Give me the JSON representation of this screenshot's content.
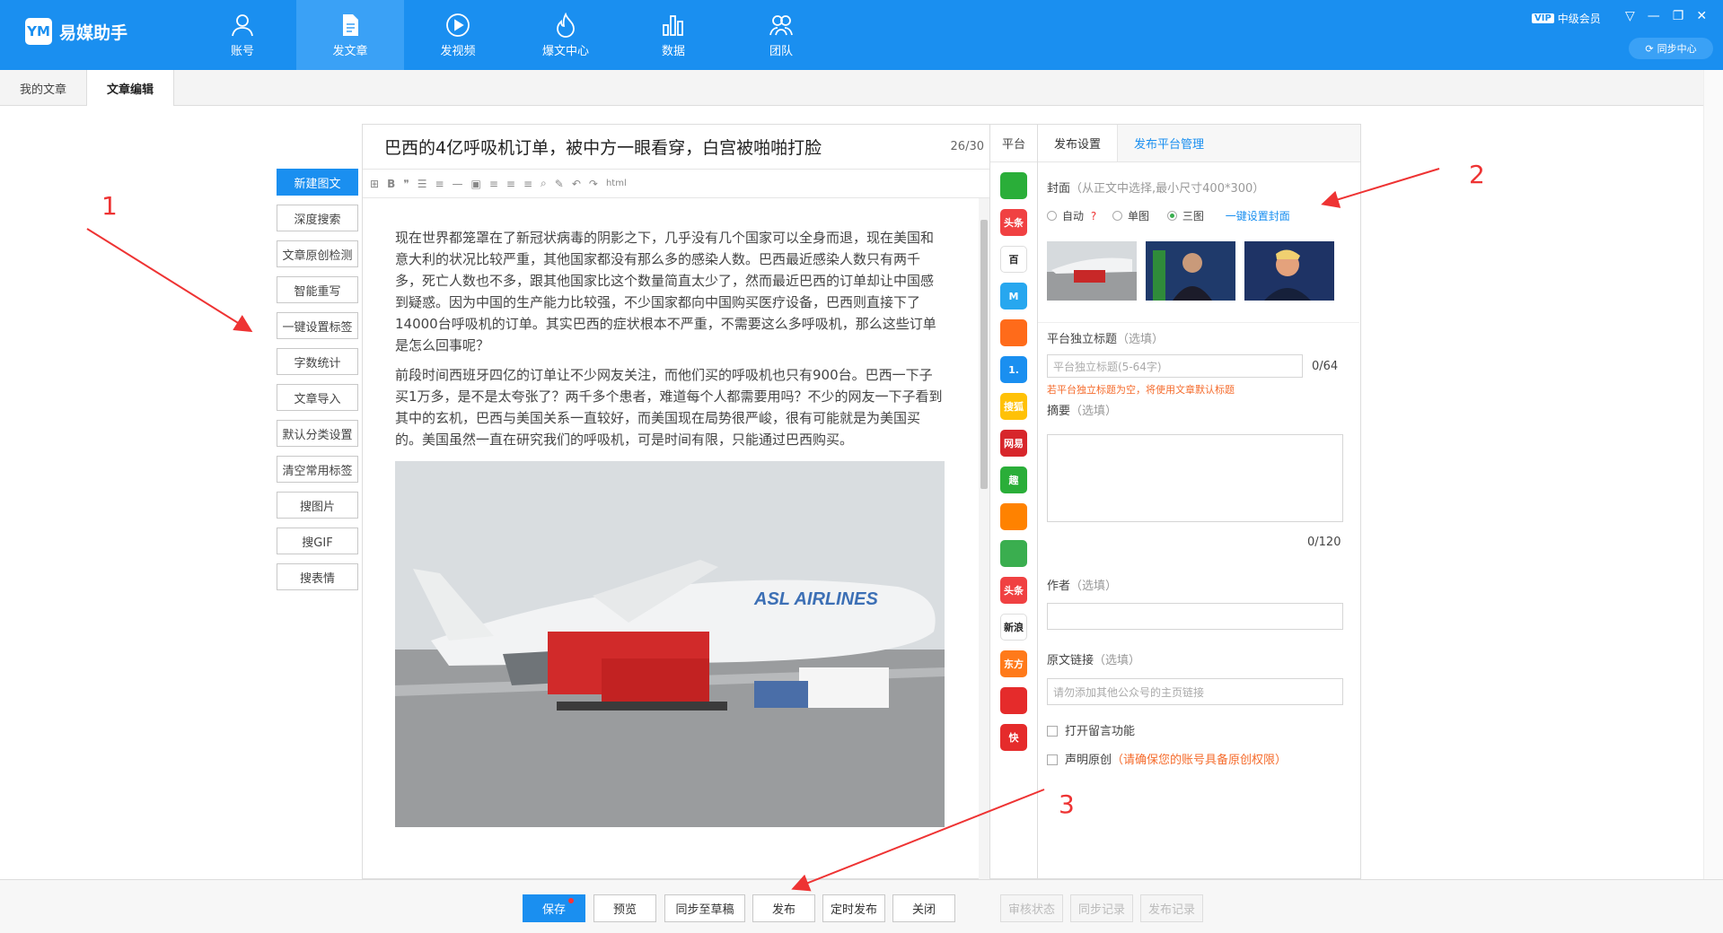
{
  "app": {
    "name": "易媒助手",
    "logo_text": "YM"
  },
  "nav": [
    {
      "label": "账号",
      "icon": "user-icon",
      "active": false
    },
    {
      "label": "发文章",
      "icon": "document-icon",
      "active": true
    },
    {
      "label": "发视频",
      "icon": "play-icon",
      "active": false
    },
    {
      "label": "爆文中心",
      "icon": "fire-icon",
      "active": false
    },
    {
      "label": "数据",
      "icon": "bar-chart-icon",
      "active": false
    },
    {
      "label": "团队",
      "icon": "team-icon",
      "active": false
    }
  ],
  "account": {
    "vip_badge": "VIP",
    "level": "中级会员",
    "sync_center": "同步中心"
  },
  "tabs": [
    {
      "label": "我的文章",
      "active": false
    },
    {
      "label": "文章编辑",
      "active": true
    }
  ],
  "tools": [
    "新建图文",
    "深度搜索",
    "文章原创检测",
    "智能重写",
    "一键设置标签",
    "字数统计",
    "文章导入",
    "默认分类设置",
    "清空常用标签",
    "搜图片",
    "搜GIF",
    "搜表情"
  ],
  "editor": {
    "title": "巴西的4亿呼吸机订单，被中方一眼看穿，白宫被啪啪打脸",
    "title_count": "26/30",
    "toolbar_html": "html",
    "paragraphs": [
      "现在世界都笼罩在了新冠状病毒的阴影之下，几乎没有几个国家可以全身而退，现在美国和意大利的状况比较严重，其他国家都没有那么多的感染人数。巴西最近感染人数只有两千多，死亡人数也不多，跟其他国家比这个数量简直太少了，然而最近巴西的订单却让中国感到疑惑。因为中国的生产能力比较强，不少国家都向中国购买医疗设备，巴西则直接下了14000台呼吸机的订单。其实巴西的症状根本不严重，不需要这么多呼吸机，那么这些订单是怎么回事呢？",
      "前段时间西班牙四亿的订单让不少网友关注，而他们买的呼吸机也只有900台。巴西一下子买1万多，是不是太夸张了？两千多个患者，难道每个人都需要用吗？不少的网友一下子看到其中的玄机，巴西与美国关系一直较好，而美国现在局势很严峻，很有可能就是为美国买的。美国虽然一直在研究我们的呼吸机，可是时间有限，只能通过巴西购买。"
    ],
    "image_caption": "ASL AIRLINES"
  },
  "platforms": {
    "header": "平台",
    "items": [
      {
        "name": "wechat-icon",
        "text": "",
        "color": "#2aae39"
      },
      {
        "name": "toutiao-icon",
        "text": "头条",
        "color": "#f04142"
      },
      {
        "name": "baijia-icon",
        "text": "百",
        "color": "#ffffff"
      },
      {
        "name": "dayu-icon",
        "text": "M",
        "color": "#27a7ef"
      },
      {
        "name": "qq-icon",
        "text": "",
        "color": "#ff6b1a"
      },
      {
        "name": "yidian-icon",
        "text": "1.",
        "color": "#1a8ff0"
      },
      {
        "name": "sohu-icon",
        "text": "搜狐",
        "color": "#ffc107"
      },
      {
        "name": "netease-icon",
        "text": "网易",
        "color": "#d7262b"
      },
      {
        "name": "qutoutiao-icon",
        "text": "趣",
        "color": "#2aae39"
      },
      {
        "name": "weibo-icon",
        "text": "",
        "color": "#ff8200"
      },
      {
        "name": "green-icon",
        "text": "",
        "color": "#3aae4f"
      },
      {
        "name": "toutiao2-icon",
        "text": "头条",
        "color": "#f04142"
      },
      {
        "name": "xinlang-icon",
        "text": "新浪",
        "color": "#ffffff"
      },
      {
        "name": "orange-icon",
        "text": "东方",
        "color": "#ff7a1a"
      },
      {
        "name": "fenghuang-icon",
        "text": "",
        "color": "#e52b2b"
      },
      {
        "name": "red-icon",
        "text": "快",
        "color": "#e52b2b"
      }
    ]
  },
  "settings": {
    "tab_publish": "发布设置",
    "tab_platform": "发布平台管理",
    "cover_label": "封面",
    "cover_hint": "（从正文中选择,最小尺寸400*300）",
    "radio_auto": "自动",
    "radio_single": "单图",
    "radio_three": "三图",
    "one_click_cover": "一键设置封面",
    "title_label": "平台独立标题",
    "optional": "（选填）",
    "title_placeholder": "平台独立标题(5-64字)",
    "title_count": "0/64",
    "title_warning": "若平台独立标题为空，将使用文章默认标题",
    "summary_label": "摘要",
    "summary_count": "0/120",
    "author_label": "作者",
    "link_label": "原文链接",
    "link_placeholder": "请勿添加其他公众号的主页链接",
    "comment_label": "打开留言功能",
    "original_label": "声明原创",
    "original_warning": "（请确保您的账号具备原创权限）"
  },
  "bottom": {
    "save": "保存",
    "preview": "预览",
    "sync_draft": "同步至草稿",
    "publish": "发布",
    "schedule": "定时发布",
    "close": "关闭",
    "review_status": "审核状态",
    "sync_record": "同步记录",
    "publish_record": "发布记录"
  },
  "annotations": {
    "n1": "1",
    "n2": "2",
    "n3": "3"
  },
  "colors": {
    "brand": "#1a8ff0",
    "annotation": "#e33333",
    "warning": "#f56c2d"
  }
}
